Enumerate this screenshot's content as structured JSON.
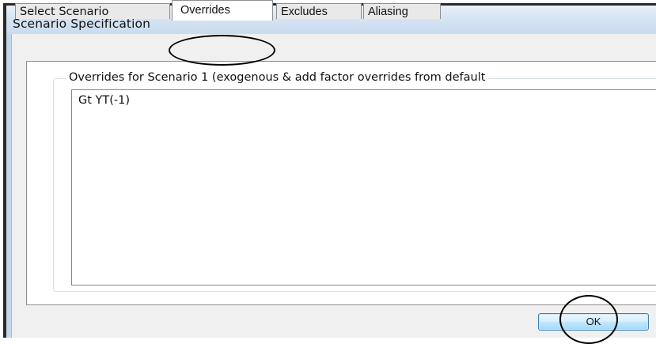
{
  "window": {
    "title": "Scenario Specification"
  },
  "tabs": [
    {
      "label": "Select Scenario",
      "active": false
    },
    {
      "label": "Overrides",
      "active": true
    },
    {
      "label": "Excludes",
      "active": false
    },
    {
      "label": "Aliasing",
      "active": false
    }
  ],
  "overrides": {
    "group_label": "Overrides for Scenario 1 (exogenous & add factor overrides from default",
    "value": "Gt YT(-1)"
  },
  "buttons": {
    "ok_label": "OK"
  },
  "colors": {
    "titlebar": "#d6e4f3",
    "ok_button": "#bee6fd",
    "annotation": "#000000"
  }
}
